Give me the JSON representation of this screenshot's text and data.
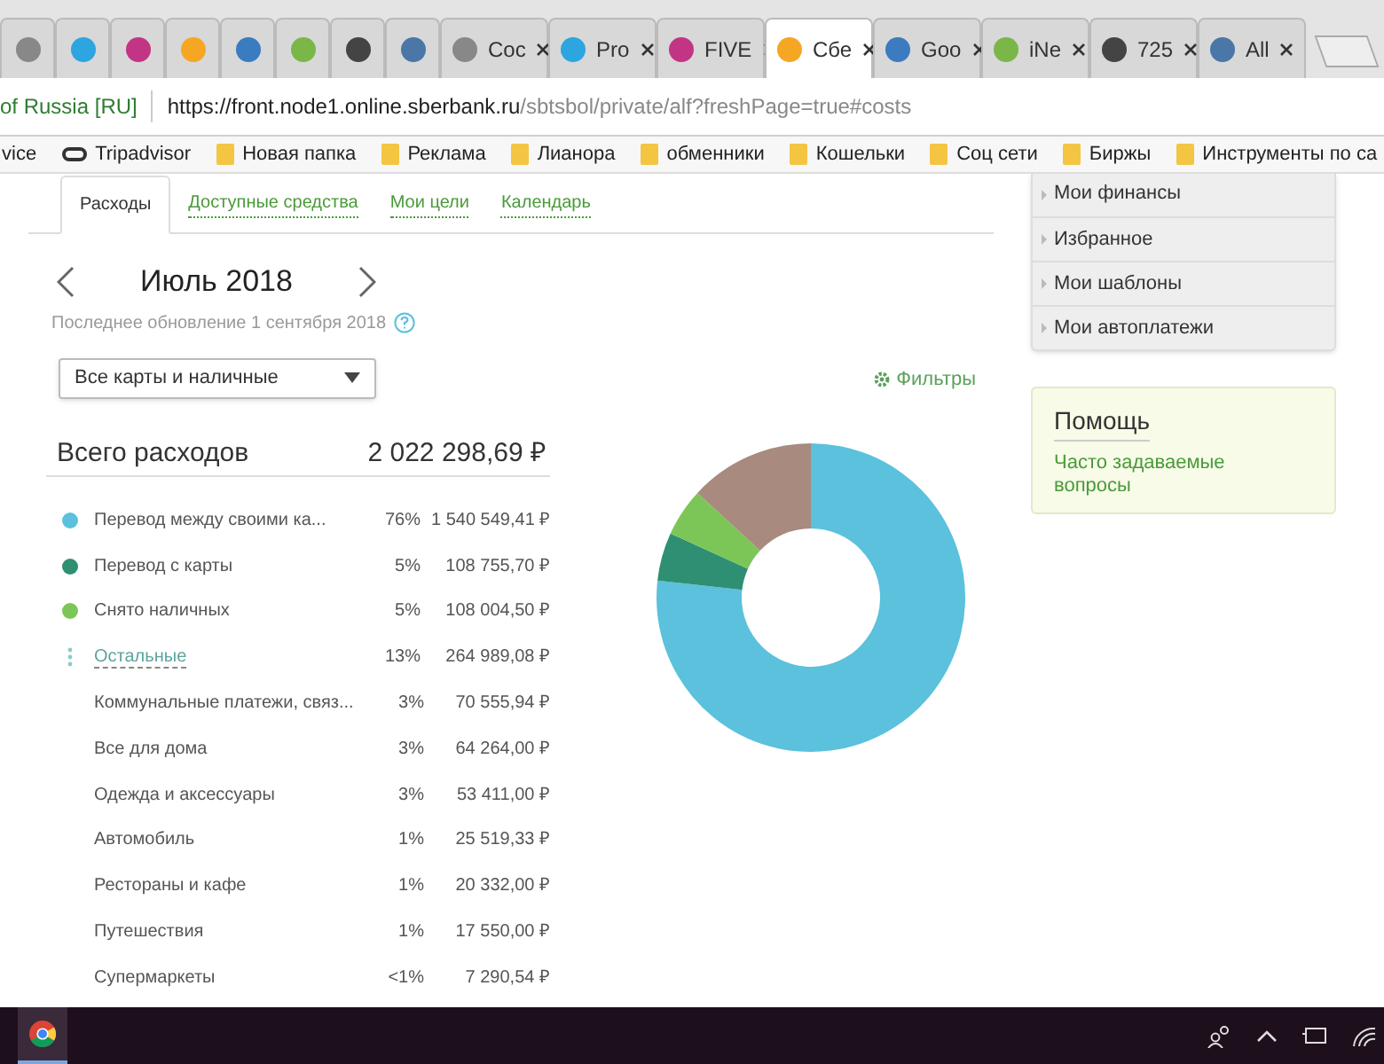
{
  "browser": {
    "tabs": [
      {
        "kind": "icon",
        "selected": false
      },
      {
        "kind": "icon",
        "selected": false
      },
      {
        "kind": "icon",
        "selected": false
      },
      {
        "kind": "icon",
        "selected": false
      },
      {
        "kind": "icon",
        "selected": false
      },
      {
        "kind": "icon",
        "selected": false
      },
      {
        "kind": "icon",
        "selected": false
      },
      {
        "kind": "icon",
        "selected": false
      },
      {
        "kind": "label",
        "label": "Coc",
        "selected": false
      },
      {
        "kind": "label",
        "label": "Pro",
        "selected": false
      },
      {
        "kind": "label",
        "label": "FIVE",
        "selected": false
      },
      {
        "kind": "label",
        "label": "Сбе",
        "selected": true
      },
      {
        "kind": "label",
        "label": "Goo",
        "selected": false
      },
      {
        "kind": "label",
        "label": "iNe",
        "selected": false
      },
      {
        "kind": "label",
        "label": "725",
        "selected": false
      },
      {
        "kind": "label",
        "label": "All",
        "selected": false
      }
    ],
    "address": {
      "site_label": "of Russia [RU]",
      "url_host": "https://front.node1.online.sberbank.ru",
      "url_path": "/sbtsbol/private/alf?freshPage=true#costs"
    },
    "bookmarks": [
      {
        "kind": "plain",
        "label": "vice"
      },
      {
        "kind": "site",
        "label": "Tripadvisor"
      },
      {
        "kind": "folder",
        "label": "Новая папка"
      },
      {
        "kind": "folder",
        "label": "Реклама"
      },
      {
        "kind": "folder",
        "label": "Лианора"
      },
      {
        "kind": "folder",
        "label": "обменники"
      },
      {
        "kind": "folder",
        "label": "Кошельки"
      },
      {
        "kind": "folder",
        "label": "Соц сети"
      },
      {
        "kind": "folder",
        "label": "Биржы"
      },
      {
        "kind": "folder",
        "label": "Инструменты по са"
      }
    ]
  },
  "tabs": [
    {
      "label": "Расходы",
      "selected": true
    },
    {
      "label": "Доступные средства",
      "selected": false
    },
    {
      "label": "Мои цели",
      "selected": false
    },
    {
      "label": "Календарь",
      "selected": false
    }
  ],
  "period": {
    "title": "Июль 2018",
    "updated": "Последнее обновление 1 сентября 2018"
  },
  "card_select": {
    "value": "Все карты и наличные"
  },
  "filters_link": "Фильтры",
  "total": {
    "label": "Всего расходов",
    "amount": "2 022 298,69 ₽"
  },
  "rows": [
    {
      "kind": "category",
      "name": "Перевод между своими ка...",
      "share": "76%",
      "amount": "1 540 549,41 ₽",
      "color": "#5bc1dc"
    },
    {
      "kind": "category",
      "name": "Перевод с карты",
      "share": "5%",
      "amount": "108 755,70 ₽",
      "color": "#2f8f72"
    },
    {
      "kind": "category",
      "name": "Снято наличных",
      "share": "5%",
      "amount": "108 004,50 ₽",
      "color": "#7cc657"
    },
    {
      "kind": "others",
      "name": "Остальные",
      "share": "13%",
      "amount": "264 989,08 ₽"
    },
    {
      "kind": "sub",
      "name": "Коммунальные платежи, связ...",
      "share": "3%",
      "amount": "70 555,94 ₽"
    },
    {
      "kind": "sub",
      "name": "Все для дома",
      "share": "3%",
      "amount": "64 264,00 ₽"
    },
    {
      "kind": "sub",
      "name": "Одежда и аксессуары",
      "share": "3%",
      "amount": "53 411,00 ₽"
    },
    {
      "kind": "sub",
      "name": "Автомобиль",
      "share": "1%",
      "amount": "25 519,33 ₽"
    },
    {
      "kind": "sub",
      "name": "Рестораны и кафе",
      "share": "1%",
      "amount": "20 332,00 ₽"
    },
    {
      "kind": "sub",
      "name": "Путешествия",
      "share": "1%",
      "amount": "17 550,00 ₽"
    },
    {
      "kind": "sub",
      "name": "Супермаркеты",
      "share": "<1%",
      "amount": "7 290,54 ₽"
    }
  ],
  "chart_data": {
    "type": "donut",
    "series": [
      {
        "values": [
          76,
          5,
          5,
          13
        ]
      }
    ],
    "colors": [
      "#5bc1dc",
      "#2f8f72",
      "#7cc657",
      "#a88a7e"
    ]
  },
  "sidebar": {
    "menu": [
      "Мои финансы",
      "Избранное",
      "Мои шаблоны",
      "Мои автоплатежи"
    ],
    "help": {
      "title": "Помощь",
      "link": "Часто задаваемые вопросы"
    }
  }
}
